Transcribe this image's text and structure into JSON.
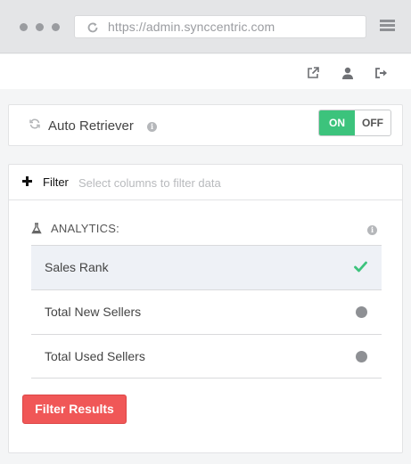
{
  "browser": {
    "url": "https://admin.synccentric.com",
    "icons": [
      "refresh-icon",
      "hamburger-menu-icon"
    ]
  },
  "toolbar": {
    "icons": [
      "external-link-icon",
      "user-icon",
      "sign-out-icon"
    ]
  },
  "retriever": {
    "label": "Auto Retriever",
    "toggle_on": "ON",
    "toggle_off": "OFF",
    "state": "ON"
  },
  "filter": {
    "label": "Filter",
    "placeholder": "Select columns to filter data",
    "section_title": "ANALYTICS:",
    "items": [
      {
        "label": "Sales Rank",
        "selected": true
      },
      {
        "label": "Total New Sellers",
        "selected": false
      },
      {
        "label": "Total Used Sellers",
        "selected": false
      }
    ],
    "button_label": "Filter Results"
  },
  "colors": {
    "accent_green": "#3cc37c",
    "button_red": "#f05757",
    "selected_row": "#eef1f6"
  }
}
